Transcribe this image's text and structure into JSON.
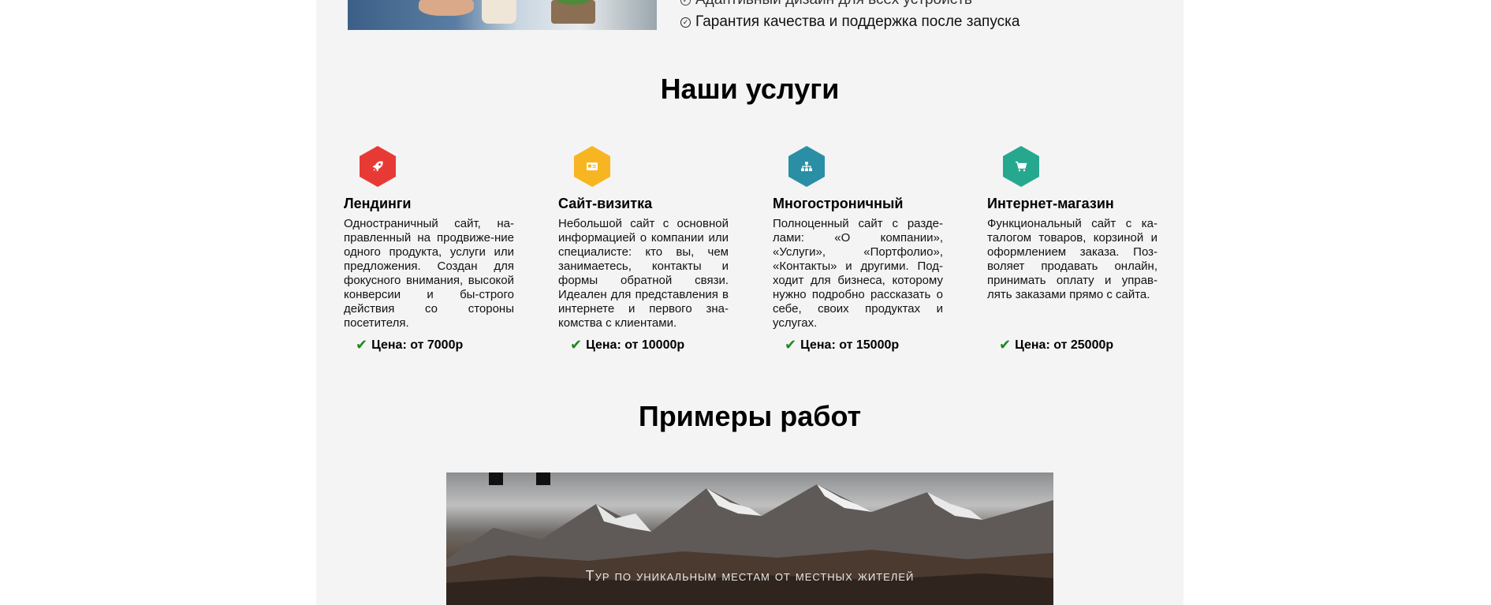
{
  "intro": {
    "list": [
      {
        "text": "Адаптивный дизайн для всех устройств",
        "icon": "check-circle-icon"
      },
      {
        "text": "Гарантия качества и поддержка после запуска",
        "icon": "check-circle-icon"
      }
    ]
  },
  "services": {
    "title": "Наши услуги",
    "items": [
      {
        "name": "Лендинги",
        "icon": "rocket-icon",
        "color": "#e83a35",
        "description": "Одностраничный сайт, на-правленный на продвиже-ние одного продукта, услуги или предложения. Создан для фокусного внимания, высокой конверсии и бы-строго действия со стороны посетителя.",
        "price": "Цена: от 7000р"
      },
      {
        "name": "Сайт-визитка",
        "icon": "id-card-icon",
        "color": "#f7b521",
        "description": "Небольшой сайт с основной информацией о компании или специалисте: кто вы, чем занимаетесь, контакты и формы обратной связи. Идеален для представления в интернете и первого зна-комства с клиентами.",
        "price": "Цена: от 10000р"
      },
      {
        "name": "Многостроничный",
        "icon": "sitemap-icon",
        "color": "#2a8fa5",
        "description": "Полноценный сайт с разде-лами: «О компании», «Услуги», «Портфолио», «Контакты» и другими. Под-ходит для бизнеса, которому нужно подробно рассказать о себе, своих продуктах и услугах.",
        "price": "Цена: от 15000р"
      },
      {
        "name": "Интернет-магазин",
        "icon": "cart-icon",
        "color": "#26a88f",
        "description": "Функциональный сайт с ка-талогом товаров, корзиной и оформлением заказа. Поз-воляет продавать онлайн, принимать оплату и управ-лять заказами прямо с сайта.",
        "price": "Цена: от 25000р"
      }
    ]
  },
  "works": {
    "title": "Примеры работ",
    "preview_caption": "Тур по уникальным местам от местных жителей"
  }
}
